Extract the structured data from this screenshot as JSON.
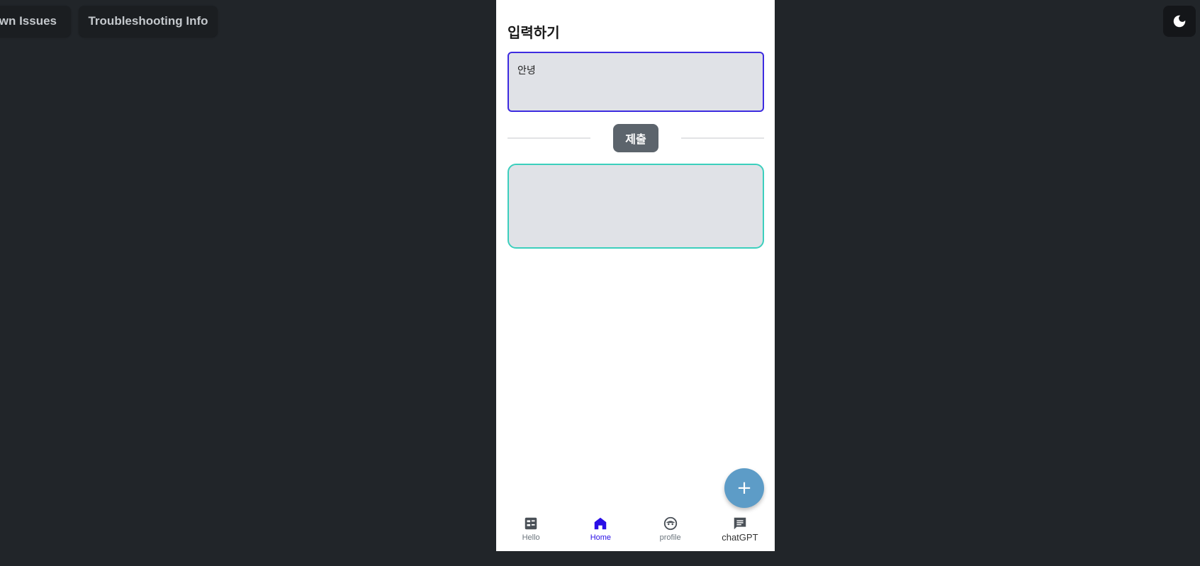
{
  "top_bar": {
    "known_issues_label": "Known Issues",
    "known_issues_visible": "own Issues",
    "troubleshooting_label": "Troubleshooting Info",
    "theme_toggle_icon": "moon-icon"
  },
  "app": {
    "title": "입력하기",
    "input_value": "안녕",
    "submit_label": "제출",
    "output_value": "",
    "fab_label": "+",
    "colors": {
      "input_border": "#3d2be0",
      "output_border": "#3ccfbd",
      "submit_bg": "#5c646c",
      "fab_bg": "#5d9cc7",
      "active_nav": "#2a0fe6"
    }
  },
  "nav": {
    "items": [
      {
        "label": "Hello",
        "icon": "list-icon",
        "active": false
      },
      {
        "label": "Home",
        "icon": "home-icon",
        "active": true
      },
      {
        "label": "profile",
        "icon": "face-icon",
        "active": false
      },
      {
        "label": "chatGPT",
        "icon": "chat-icon",
        "active": false
      }
    ]
  }
}
